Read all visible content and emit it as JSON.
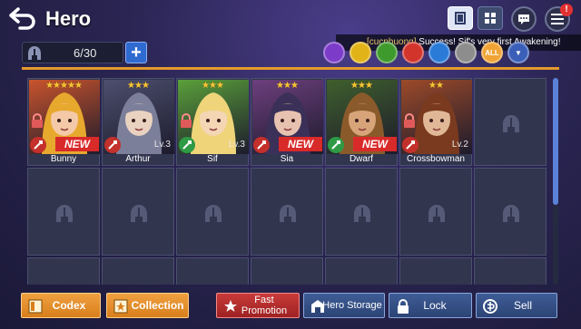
{
  "header": {
    "title": "Hero",
    "icons": [
      "back-arrow-icon",
      "card-view-icon",
      "grid-view-icon",
      "chat-icon",
      "menu-icon"
    ],
    "menu_badge": "!"
  },
  "notification": {
    "user": "[cucphuong]",
    "message": "Success! Sif's very first Awakening!"
  },
  "inventory": {
    "count": "6/30",
    "add_label": "+"
  },
  "filters": [
    {
      "name": "dark-element",
      "color": "#7c3cc9",
      "text": ""
    },
    {
      "name": "light-element",
      "color": "#e2b318",
      "text": ""
    },
    {
      "name": "earth-element",
      "color": "#3f9a2d",
      "text": ""
    },
    {
      "name": "fire-element",
      "color": "#d2342b",
      "text": ""
    },
    {
      "name": "water-element",
      "color": "#2a7ad8",
      "text": ""
    },
    {
      "name": "neutral-element",
      "color": "#8d8d8d",
      "text": ""
    },
    {
      "name": "all-element",
      "color": "#f0a435",
      "text": "ALL"
    },
    {
      "name": "dropdown",
      "color": "#3a5fb8",
      "text": "▼"
    }
  ],
  "heroes": [
    {
      "name": "Bunny",
      "stars": "★★★★★",
      "tag": "NEW",
      "level": "",
      "class_color": "#c4302b",
      "skin": "#f4c9a7",
      "hair": "#e7a82e",
      "bg": "#c9542d",
      "locked": true
    },
    {
      "name": "Arthur",
      "stars": "★★★",
      "tag": "",
      "level": "Lv.3",
      "class_color": "#c4302b",
      "skin": "#e9d2c0",
      "hair": "#7b7f99",
      "bg": "#4c4f6e",
      "locked": false
    },
    {
      "name": "Sif",
      "stars": "★★★",
      "tag": "",
      "level": "Lv.3",
      "class_color": "#2f9a45",
      "skin": "#f4d6b5",
      "hair": "#efd47a",
      "bg": "#5aa03a",
      "locked": true
    },
    {
      "name": "Sia",
      "stars": "★★★",
      "tag": "NEW",
      "level": "",
      "class_color": "#c4302b",
      "skin": "#e7c2b0",
      "hair": "#3b3058",
      "bg": "#6d3f7e",
      "locked": false
    },
    {
      "name": "Dwarf",
      "stars": "★★★",
      "tag": "NEW",
      "level": "",
      "class_color": "#2f9a45",
      "skin": "#d7a47a",
      "hair": "#8b5a2b",
      "bg": "#3f5f2d",
      "locked": false
    },
    {
      "name": "Crossbowman",
      "stars": "★★",
      "tag": "",
      "level": "Lv.2",
      "class_color": "#c4302b",
      "skin": "#e0b897",
      "hair": "#7a3a1f",
      "bg": "#9c4a2a",
      "locked": true
    }
  ],
  "buttons": {
    "codex": "Codex",
    "collection": "Collection",
    "fast_promotion_1": "Fast",
    "fast_promotion_2": "Promotion",
    "hero_storage": "Hero Storage",
    "lock": "Lock",
    "sell": "Sell"
  }
}
